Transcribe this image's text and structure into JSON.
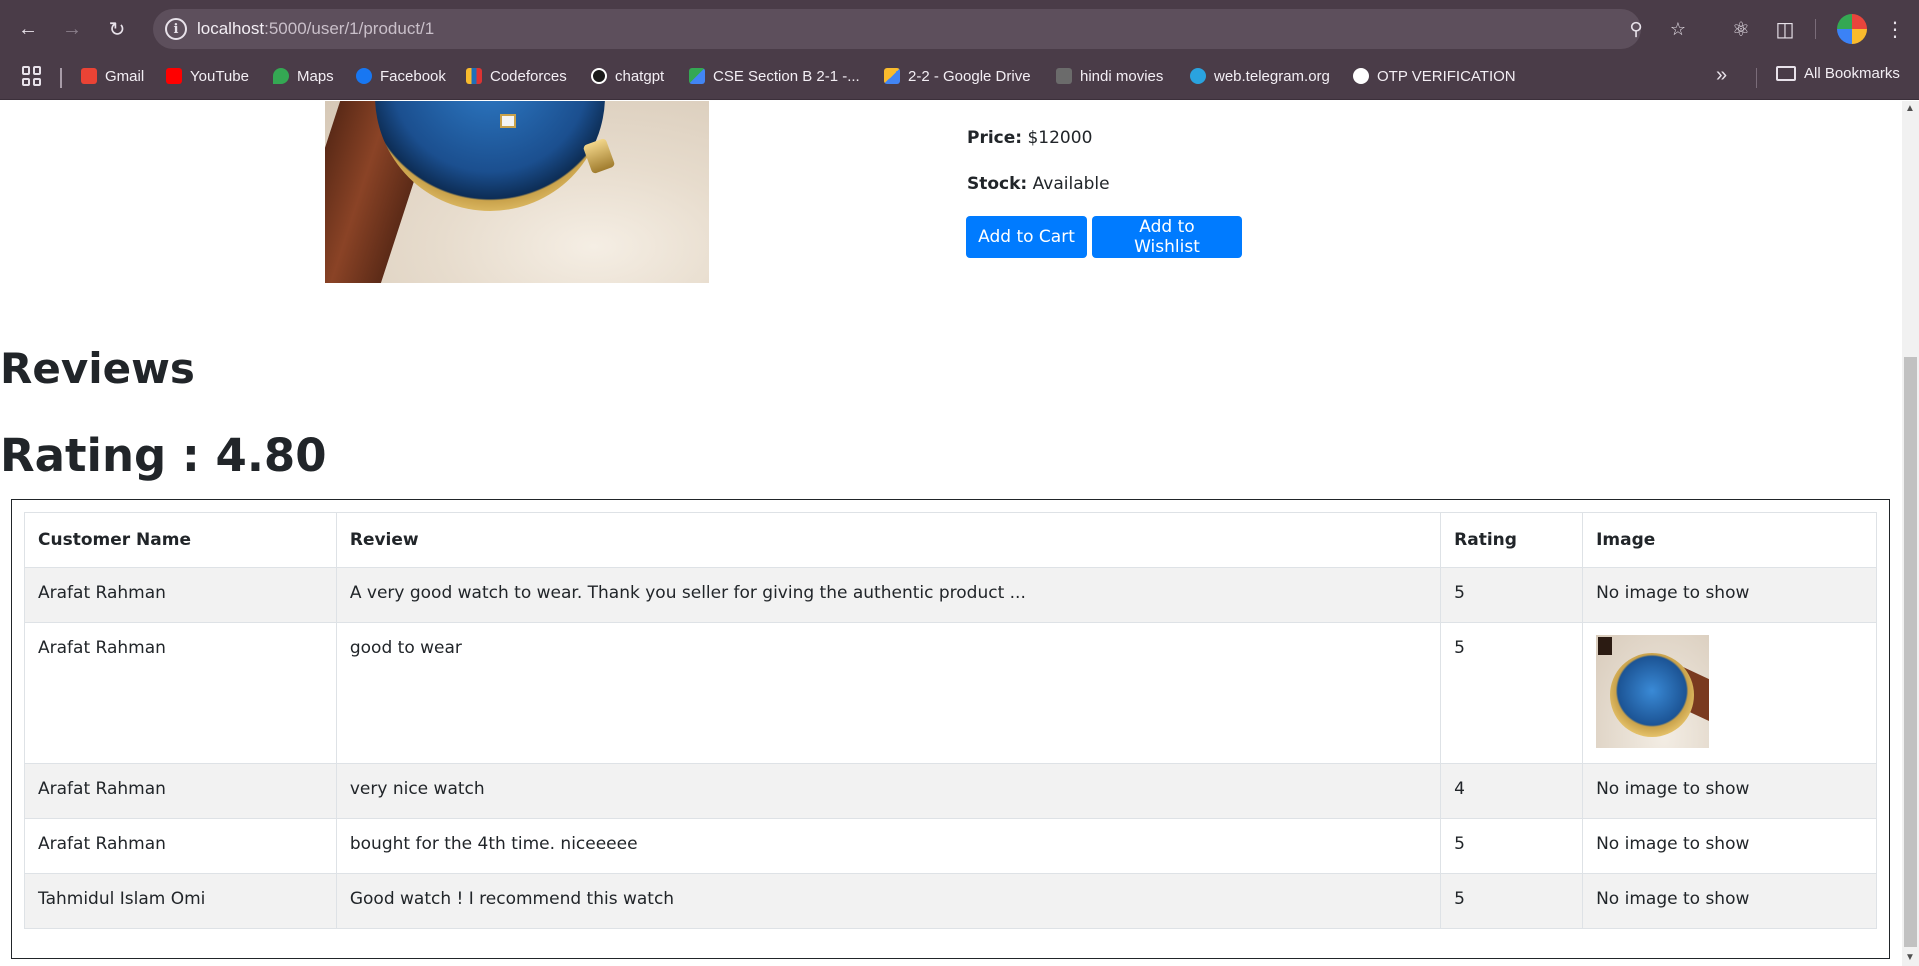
{
  "browser": {
    "url_host": "localhost",
    "url_path": ":5000/user/1/product/1",
    "back_icon": "arrow-left",
    "forward_icon": "arrow-right",
    "reload_icon": "reload",
    "bookmarks": [
      {
        "label": "Gmail",
        "color": "#ea4335"
      },
      {
        "label": "YouTube",
        "color": "#ff0000"
      },
      {
        "label": "Maps",
        "color": "#34a853"
      },
      {
        "label": "Facebook",
        "color": "#1877f2"
      },
      {
        "label": "Codeforces",
        "color": "#f9bb2d"
      },
      {
        "label": "chatgpt",
        "color": "#ffffff"
      },
      {
        "label": "CSE Section B 2-1 -...",
        "color": "#34a853"
      },
      {
        "label": "2-2 - Google Drive",
        "color": "#4285f4"
      },
      {
        "label": "hindi movies",
        "color": "#6b6b6b"
      },
      {
        "label": "web.telegram.org",
        "color": "#2aa3df"
      },
      {
        "label": "OTP VERIFICATION",
        "color": "#ffffff"
      }
    ],
    "all_bookmarks": "All Bookmarks"
  },
  "product": {
    "price_label": "Price:",
    "price_value": "$12000",
    "stock_label": "Stock:",
    "stock_value": "Available",
    "add_to_cart": "Add to Cart",
    "add_to_wishlist": "Add to Wishlist"
  },
  "reviews": {
    "heading": "Reviews",
    "rating_line": "Rating : 4.80",
    "columns": [
      "Customer Name",
      "Review",
      "Rating",
      "Image"
    ],
    "rows": [
      {
        "name": "Arafat Rahman",
        "review": "A very good watch to wear. Thank you seller for giving the authentic product ...",
        "rating": "5",
        "image": "No image to show"
      },
      {
        "name": "Arafat Rahman",
        "review": "good to wear",
        "rating": "5",
        "image": ""
      },
      {
        "name": "Arafat Rahman",
        "review": "very nice watch",
        "rating": "4",
        "image": "No image to show"
      },
      {
        "name": "Arafat Rahman",
        "review": "bought for the 4th time. niceeeee",
        "rating": "5",
        "image": "No image to show"
      },
      {
        "name": "Tahmidul Islam Omi",
        "review": "Good watch ! I recommend this watch",
        "rating": "5",
        "image": "No image to show"
      }
    ]
  },
  "colors": {
    "primary_button": "#007bff",
    "browser_chrome": "#4a3c48"
  }
}
